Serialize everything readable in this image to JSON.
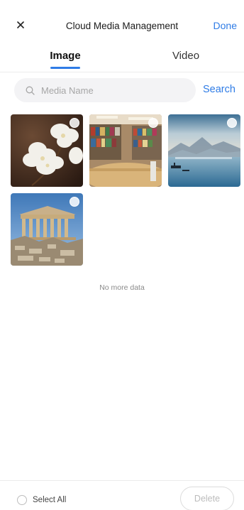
{
  "header": {
    "close_icon": "close-icon",
    "title": "Cloud Media Management",
    "done_label": "Done"
  },
  "tabs": [
    {
      "label": "Image",
      "active": true
    },
    {
      "label": "Video",
      "active": false
    }
  ],
  "search": {
    "placeholder": "Media Name",
    "value": "",
    "button_label": "Search"
  },
  "media_items": [
    {
      "subject": "white orchid flowers",
      "selected": false
    },
    {
      "subject": "library bookshelves",
      "selected": false
    },
    {
      "subject": "misty lake with mountains",
      "selected": false
    },
    {
      "subject": "ancient greek temple ruins",
      "selected": false
    }
  ],
  "list_status": "No more data",
  "footer": {
    "select_all_label": "Select All",
    "delete_label": "Delete"
  },
  "colors": {
    "accent": "#2f7ce6",
    "disabled_text": "#bcbcbc",
    "search_bg": "#f3f3f5"
  }
}
